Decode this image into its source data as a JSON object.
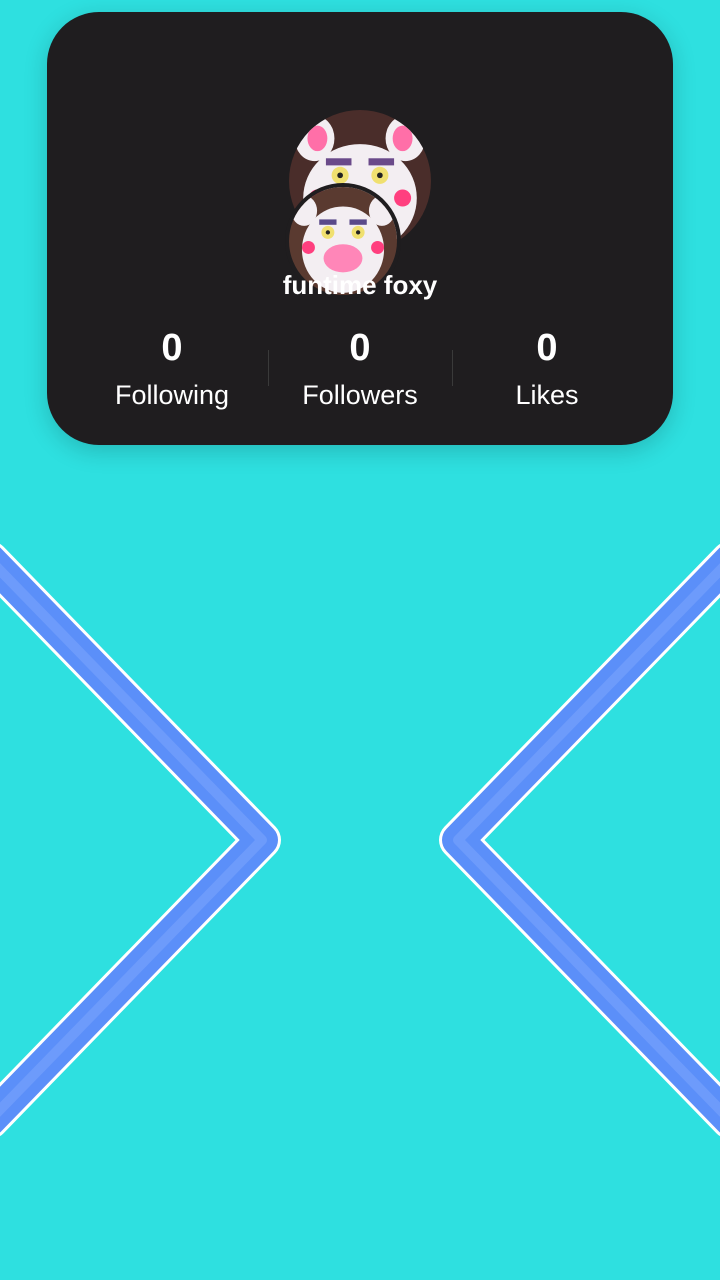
{
  "profile": {
    "username": "funtime foxy",
    "avatar_icon": "mangle-animatronic-avatar"
  },
  "stats": [
    {
      "value": "0",
      "label": "Following"
    },
    {
      "value": "0",
      "label": "Followers"
    },
    {
      "value": "0",
      "label": "Likes"
    }
  ],
  "navigation": {
    "left_icon": "chevron-left-icon",
    "right_icon": "chevron-right-icon"
  },
  "colors": {
    "background": "#2ee0e0",
    "card": "#1f1d1f",
    "chevron_stroke": "#5b8ff9",
    "chevron_outline": "#ffffff"
  }
}
